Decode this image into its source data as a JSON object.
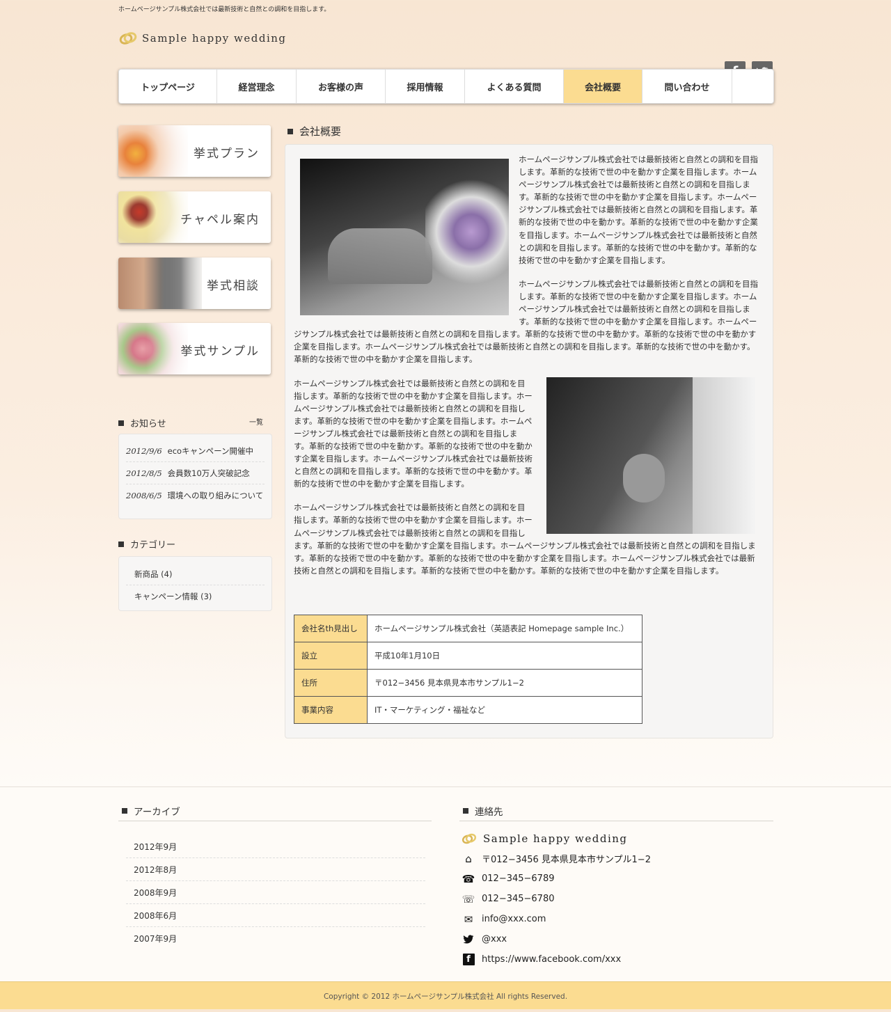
{
  "header": {
    "tagline": "ホームページサンプル株式会社では最新技術と自然との調和を目指します。",
    "logo_text": "Sample happy wedding",
    "social": [
      {
        "icon": "facebook-icon",
        "glyph": "f"
      },
      {
        "icon": "twitter-icon",
        "glyph": "🐦"
      }
    ]
  },
  "nav": {
    "items": [
      {
        "label": "トップページ"
      },
      {
        "label": "経営理念"
      },
      {
        "label": "お客様の声"
      },
      {
        "label": "採用情報"
      },
      {
        "label": "よくある質問"
      },
      {
        "label": "会社概要",
        "active": true
      },
      {
        "label": "問い合わせ"
      }
    ],
    "active_color": "#fbdc91"
  },
  "sidebar": {
    "banners": [
      {
        "label": "挙式プラン"
      },
      {
        "label": "チャペル案内"
      },
      {
        "label": "挙式相談"
      },
      {
        "label": "挙式サンプル"
      }
    ],
    "news": {
      "title": "お知らせ",
      "more": "一覧",
      "items": [
        {
          "date": "2012/9/6",
          "text": "ecoキャンペーン開催中"
        },
        {
          "date": "2012/8/5",
          "text": "会員数10万人突破記念"
        },
        {
          "date": "2008/6/5",
          "text": "環境への取り組みについて"
        }
      ]
    },
    "category": {
      "title": "カテゴリー",
      "items": [
        {
          "label": "新商品 (4)"
        },
        {
          "label": "キャンペーン情報 (3)"
        }
      ]
    }
  },
  "main": {
    "title": "会社概要",
    "para1": "ホームページサンプル株式会社では最新技術と自然との調和を目指します。革新的な技術で世の中を動かす企業を目指します。ホームページサンプル株式会社では最新技術と自然との調和を目指します。革新的な技術で世の中を動かす企業を目指します。ホームページサンプル株式会社では最新技術と自然との調和を目指します。革新的な技術で世の中を動かす。革新的な技術で世の中を動かす企業を目指します。ホームページサンプル株式会社では最新技術と自然との調和を目指します。革新的な技術で世の中を動かす。革新的な技術で世の中を動かす企業を目指します。",
    "para2": "ホームページサンプル株式会社では最新技術と自然との調和を目指します。革新的な技術で世の中を動かす企業を目指します。ホームページサンプル株式会社では最新技術と自然との調和を目指します。革新的な技術で世の中を動かす企業を目指します。ホームページサンプル株式会社では最新技術と自然との調和を目指します。革新的な技術で世の中を動かす。革新的な技術で世の中を動かす企業を目指します。ホームページサンプル株式会社では最新技術と自然との調和を目指します。革新的な技術で世の中を動かす。革新的な技術で世の中を動かす企業を目指します。",
    "para3": "ホームページサンプル株式会社では最新技術と自然との調和を目指します。革新的な技術で世の中を動かす企業を目指します。ホームページサンプル株式会社では最新技術と自然との調和を目指します。革新的な技術で世の中を動かす企業を目指します。ホームページサンプル株式会社では最新技術と自然との調和を目指します。革新的な技術で世の中を動かす。革新的な技術で世の中を動かす企業を目指します。ホームページサンプル株式会社では最新技術と自然との調和を目指します。革新的な技術で世の中を動かす。革新的な技術で世の中を動かす企業を目指します。",
    "para4": "ホームページサンプル株式会社では最新技術と自然との調和を目指します。革新的な技術で世の中を動かす企業を目指します。ホームページサンプル株式会社では最新技術と自然との調和を目指します。革新的な技術で世の中を動かす企業を目指します。ホームページサンプル株式会社では最新技術と自然との調和を目指します。革新的な技術で世の中を動かす。革新的な技術で世の中を動かす企業を目指します。ホームページサンプル株式会社では最新技術と自然との調和を目指します。革新的な技術で世の中を動かす。革新的な技術で世の中を動かす企業を目指します。",
    "table": [
      {
        "th": "会社名th見出し",
        "td": "ホームページサンプル株式会社（英語表記 Homepage sample Inc.）"
      },
      {
        "th": "設立",
        "td": "平成10年1月10日"
      },
      {
        "th": "住所",
        "td": "〒012−3456 見本県見本市サンプル1−2"
      },
      {
        "th": "事業内容",
        "td": "IT・マーケティング・福祉など"
      }
    ]
  },
  "footer": {
    "archive_title": "アーカイブ",
    "archives": [
      "2012年9月",
      "2012年8月",
      "2008年9月",
      "2008年6月",
      "2007年9月"
    ],
    "contact_title": "連絡先",
    "contact": [
      {
        "icon": "rings-icon",
        "glyph": "",
        "text": "Sample happy wedding"
      },
      {
        "icon": "home-icon",
        "glyph": "⌂",
        "text": "〒012−3456 見本県見本市サンプル1−2"
      },
      {
        "icon": "phone-icon",
        "glyph": "☎",
        "text": "012−345−6789"
      },
      {
        "icon": "fax-icon",
        "glyph": "☏",
        "text": "012−345−6780"
      },
      {
        "icon": "mail-icon",
        "glyph": "✉",
        "text": "info@xxx.com"
      },
      {
        "icon": "twitter-icon",
        "glyph": "🐦",
        "text": "@xxx"
      },
      {
        "icon": "facebook-icon",
        "glyph": "f",
        "text": "https://www.facebook.com/xxx"
      }
    ],
    "copyright": "Copyright © 2012 ホームページサンプル株式会社 All rights Reserved."
  }
}
